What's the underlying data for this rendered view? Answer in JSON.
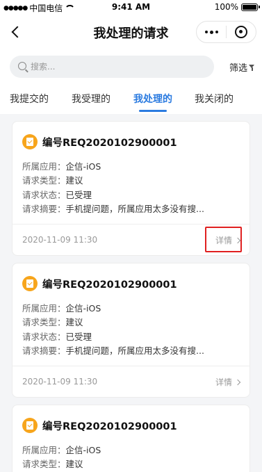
{
  "status_bar": {
    "carrier": "中国电信",
    "time": "9:41 AM",
    "battery": "100%"
  },
  "nav": {
    "title": "我处理的请求"
  },
  "search": {
    "placeholder": "搜索...",
    "filter_label": "筛选"
  },
  "tabs": [
    {
      "label": "我提交的",
      "active": false
    },
    {
      "label": "我受理的",
      "active": false
    },
    {
      "label": "我处理的",
      "active": true
    },
    {
      "label": "我关闭的",
      "active": false
    }
  ],
  "colors": {
    "accent": "#2b7be0",
    "icon_orange": "#f7a51c",
    "highlight_red": "#e02020"
  },
  "cards": [
    {
      "title": "编号REQ2020102900001",
      "fields": [
        {
          "key": "所属应用：",
          "value": "企信-iOS"
        },
        {
          "key": "请求类型：",
          "value": "建议"
        },
        {
          "key": "请求状态：",
          "value": "已受理"
        },
        {
          "key": "请求摘要：",
          "value": "手机提问题，所属应用太多没有搜..."
        }
      ],
      "date": "2020-11-09  11:30",
      "detail_label": "详情"
    },
    {
      "title": "编号REQ2020102900001",
      "fields": [
        {
          "key": "所属应用：",
          "value": "企信-iOS"
        },
        {
          "key": "请求类型：",
          "value": "建议"
        },
        {
          "key": "请求状态：",
          "value": "已受理"
        },
        {
          "key": "请求摘要：",
          "value": "手机提问题，所属应用太多没有搜..."
        }
      ],
      "date": "2020-11-09  11:30",
      "detail_label": "详情"
    },
    {
      "title": "编号REQ2020102900001",
      "fields": [
        {
          "key": "所属应用：",
          "value": "企信-iOS"
        },
        {
          "key": "请求类型：",
          "value": "建议"
        }
      ],
      "date": "",
      "detail_label": ""
    }
  ]
}
